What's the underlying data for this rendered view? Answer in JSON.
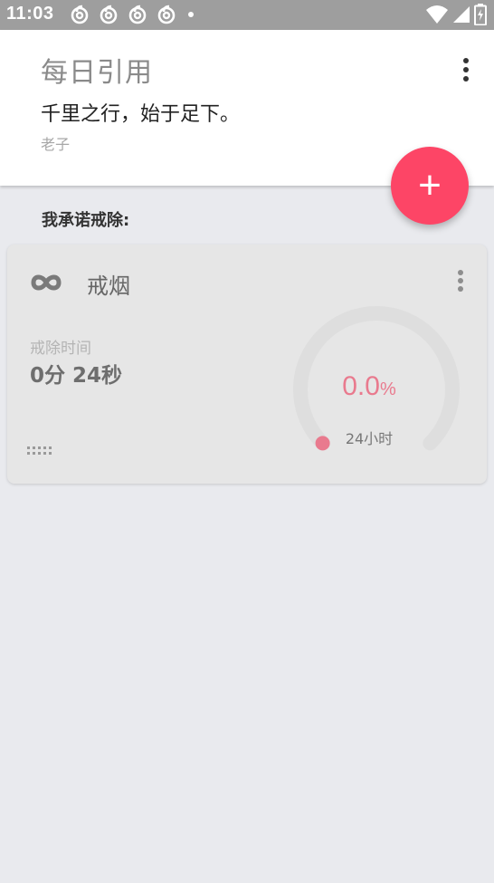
{
  "status_bar": {
    "time": "11:03",
    "notifications": [
      "netease-music-icon",
      "netease-music-icon",
      "netease-music-icon",
      "netease-music-icon"
    ],
    "indicators": [
      "wifi-icon",
      "signal-icon",
      "battery-icon"
    ]
  },
  "quote": {
    "title": "每日引用",
    "text": "千里之行，始于足下。",
    "author": "老子",
    "menu_icon": "more-vert-icon"
  },
  "fab": {
    "label": "+",
    "color": "#fd4566"
  },
  "section_label": "我承诺戒除:",
  "habit": {
    "icon": "infinity-icon",
    "name": "戒烟",
    "menu_icon": "more-vert-icon",
    "elapsed_label": "戒除时间",
    "elapsed_value": "0分 24秒",
    "progress_value": "0.0",
    "progress_unit": "%",
    "progress_fraction": 0.0,
    "goal_label": "24小时",
    "accent_color": "#e97a8e",
    "drag_icon": "drag-handle-icon"
  }
}
